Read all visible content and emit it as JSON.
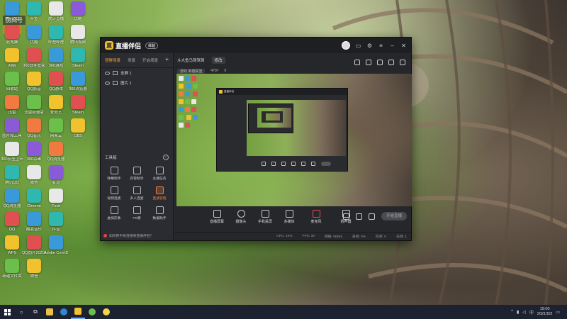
{
  "desktop": {
    "room_label": "房间号",
    "room_number": "4797",
    "icons_col1": [
      "腾讯QQ",
      "此电脑",
      "网络",
      "回收站",
      "迅雷",
      "图片和工具",
      "360安全卫士",
      "腾讯QQ",
      "QQ浏览器",
      "QQ",
      "WPS",
      "新建文件夹"
    ],
    "icons_col2": [
      "斗鱼",
      "优酷",
      "360软件管家",
      "QQ影音",
      "迅雷极速版",
      "QQ音乐",
      "360杀毒",
      "微信",
      "Chrome",
      "酷我音乐",
      "QQ图片2020216",
      "微信"
    ],
    "icons_col3": [
      "虎牙直播",
      "哔哩哔哩",
      "360游戏",
      "QQ游戏",
      "爱奇艺",
      "网易云",
      "QQ浏览器",
      "有道",
      "Foxit",
      "抖音",
      "Adobe CorelDraw"
    ],
    "icons_col4": [
      "优酷",
      "腾讯视频",
      "Steam",
      "360浏览器",
      "Steam",
      "OBS"
    ]
  },
  "window": {
    "app_name": "直播伴侣",
    "version": "体验",
    "scene_tabs": [
      "竖屏场景",
      "场景",
      "开启场景"
    ],
    "sources": [
      "全屏 1",
      "图片 1"
    ],
    "toolbox_label": "工具箱",
    "tools": [
      "弹幕助手",
      "房管助手",
      "主播任务",
      "视频连麦",
      "多人连麦",
      "直播管理",
      "虚拟形象",
      "PK赛",
      "数据助手"
    ],
    "notice": "如何把手机连接到直播伴侣？",
    "room_title": "斗大鱼马驾驾驾",
    "room_sub_button": "修改",
    "category": "游戏  英雄联盟",
    "viewer_count": "4797",
    "like_count": "0",
    "controls": [
      "直播屏幕",
      "摄像头",
      "手机投屏",
      "多媒体",
      "麦克风",
      "扬声器"
    ],
    "start_label": "开始直播",
    "status": [
      "CPU: 10%",
      "FPS: 30",
      "网络: 0KB/s",
      "丢帧: 0%",
      "码率: 0",
      "在线: 1"
    ]
  },
  "taskbar": {
    "time": "19:00",
    "date": "2021/5/2",
    "tray_language": "中"
  },
  "colors": {
    "accent": "#f0a03a",
    "hot": "#f07a40",
    "window_bg": "#26272b",
    "taskbar": "#1c2230"
  }
}
